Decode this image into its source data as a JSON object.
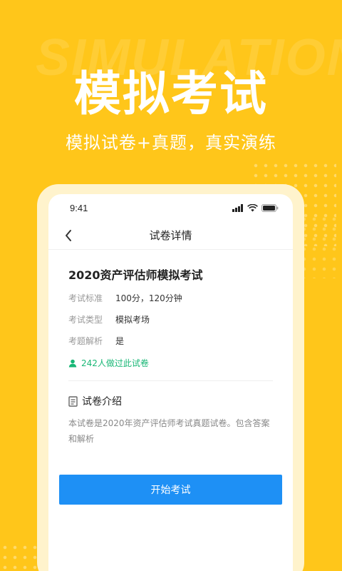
{
  "promo": {
    "bg_word": "SIMULATION",
    "title": "模拟考试",
    "subtitle": "模拟试卷+真题，真实演练"
  },
  "status_bar": {
    "time": "9:41",
    "icons": [
      "signal-icon",
      "wifi-icon",
      "battery-icon"
    ]
  },
  "nav": {
    "back_icon": "chevron-left-icon",
    "title": "试卷详情"
  },
  "exam": {
    "title": "2020资产评估师模拟考试",
    "info": [
      {
        "label": "考试标准",
        "value": "100分，120分钟"
      },
      {
        "label": "考试类型",
        "value": "模拟考场"
      },
      {
        "label": "考题解析",
        "value": "是"
      }
    ],
    "people_icon": "person-icon",
    "people_text": "242人做过此试卷"
  },
  "intro": {
    "icon": "document-icon",
    "heading": "试卷介绍",
    "body": "本试卷是2020年资产评估师考试真题试卷。包含答案和解析"
  },
  "actions": {
    "start_label": "开始考试"
  },
  "colors": {
    "background": "#FFC61A",
    "primary_button": "#1E90F5",
    "green_text": "#19B776"
  }
}
